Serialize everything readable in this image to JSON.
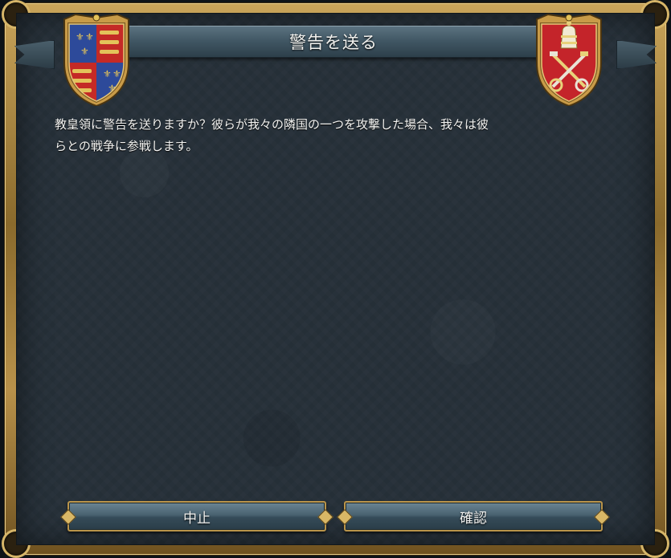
{
  "dialog": {
    "title": "警告を送る",
    "message": "教皇領に警告を送りますか？彼らが我々の隣国の一つを攻撃した場合、我々は彼\nらとの戦争に参戦します。",
    "buttons": {
      "cancel_label": "中止",
      "confirm_label": "確認"
    },
    "left_shield": {
      "icon": "england-royal-arms-shield-icon",
      "colors": {
        "blue": "#2d4a9a",
        "red": "#c42a26",
        "gold": "#e3c35a"
      }
    },
    "right_shield": {
      "icon": "papal-keys-shield-icon",
      "colors": {
        "red": "#c4242a",
        "gold": "#e8d27a"
      }
    }
  }
}
